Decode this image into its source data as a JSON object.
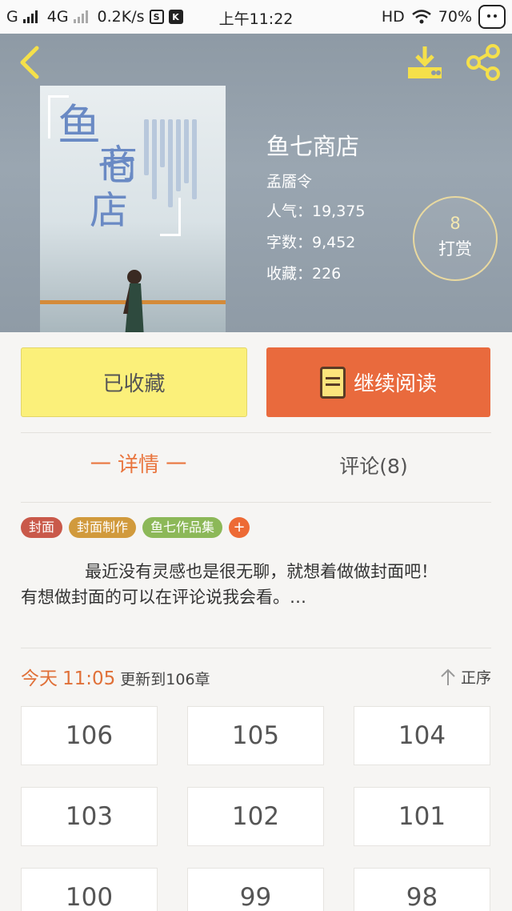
{
  "status_bar": {
    "network_label": "G",
    "network2_label": "4G",
    "speed": "0.2K/s",
    "icon_s": "S",
    "icon_k": "K",
    "time": "上午11:22",
    "hd": "HD",
    "battery": "70%"
  },
  "book": {
    "title": "鱼七商店",
    "author": "孟靥令",
    "popularity": "人气：19,375",
    "word_count": "字数：9,452",
    "favorites": "收藏：226",
    "reward_count": "8",
    "reward_label": "打赏"
  },
  "cover": {
    "chars": [
      "鱼",
      "七",
      "商",
      "店"
    ]
  },
  "actions": {
    "collected_label": "已收藏",
    "read_label": "继续阅读"
  },
  "tabs": {
    "detail": "一 详情 一",
    "comments": "评论(8)"
  },
  "tags": [
    {
      "label": "封面",
      "color": "#c9594a"
    },
    {
      "label": "封面制作",
      "color": "#d19a3c"
    },
    {
      "label": "鱼七作品集",
      "color": "#8cb858"
    }
  ],
  "tag_add": "+",
  "description": "            最近没有灵感也是很无聊，就想着做做封面吧！\n有想做封面的可以在评论说我会看。…",
  "update": {
    "today": "今天",
    "time": "11:05",
    "text": "更新到106章"
  },
  "sort_label": "正序",
  "chapters": [
    "106",
    "105",
    "104",
    "103",
    "102",
    "101",
    "100",
    "99",
    "98"
  ],
  "colors": {
    "accent_orange": "#e96a3d",
    "collected_yellow": "#fbf07a",
    "back_icon_yellow": "#f5e04a"
  },
  "icons": {
    "back": "chevron-left-icon",
    "download": "download-icon",
    "share": "share-icon",
    "book": "book-icon",
    "sort": "arrow-up-icon"
  }
}
